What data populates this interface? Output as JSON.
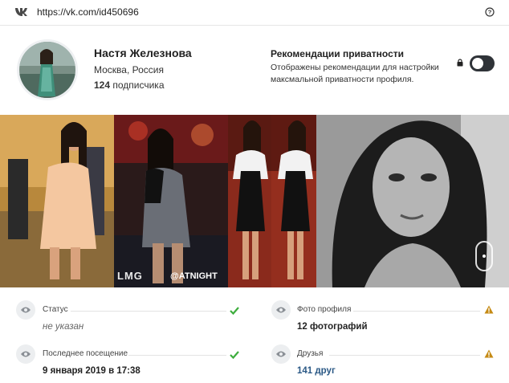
{
  "url_bar": {
    "url": "https://vk.com/id450696"
  },
  "profile": {
    "name": "Настя Железнова",
    "location": "Москва, Россия",
    "followers_count": "124",
    "followers_label": "подписчика"
  },
  "privacy_recommendations": {
    "title": "Рекомендации приватности",
    "description": "Отображены рекомендации для настройки максмальной приватности профиля.",
    "toggle_on": false
  },
  "photo_overlays": {
    "lmg": "LMG",
    "atnight": "@ATNIGHT"
  },
  "info": {
    "status": {
      "label": "Статус",
      "value": "не указан",
      "state": "ok"
    },
    "last_seen": {
      "label": "Последнее посещение",
      "value": "9 января 2019 в 17:38",
      "state": "ok"
    },
    "profile_photo": {
      "label": "Фото профиля",
      "value": "12 фотографий",
      "state": "warning"
    },
    "friends": {
      "label": "Друзья",
      "value": "141 друг",
      "state": "warning"
    }
  },
  "colors": {
    "ok": "#3dad3d",
    "warning": "#c58a14",
    "link": "#2a5885",
    "toggle": "#2f3338"
  },
  "icons": [
    "vk-logo-icon",
    "help-icon",
    "lock-icon",
    "eye-icon",
    "check-icon",
    "warning-icon"
  ]
}
